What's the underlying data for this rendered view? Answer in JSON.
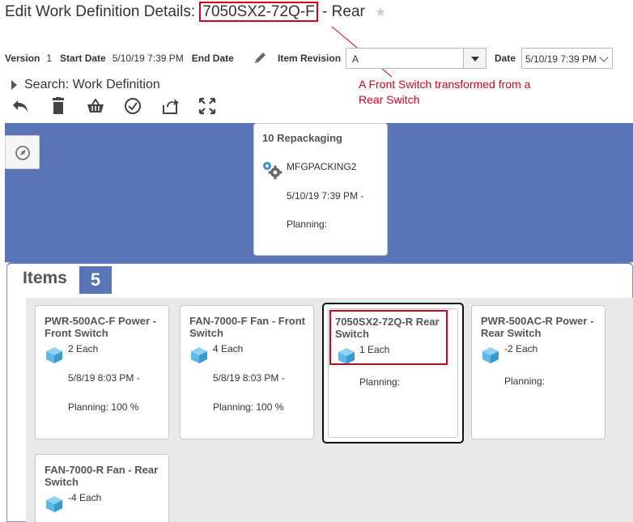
{
  "header": {
    "title_prefix": "Edit Work Definition Details: ",
    "title_item": "7050SX2-72Q-F",
    "title_suffix": " - Rear",
    "star": "★"
  },
  "details": {
    "version_label": "Version",
    "version_value": "1",
    "start_date_label": "Start Date",
    "start_date_value": "5/10/19 7:39 PM",
    "end_date_label": "End Date",
    "item_revision_label": "Item Revision",
    "item_revision_value": "A",
    "date_label": "Date",
    "date_value": "5/10/19 7:39 PM"
  },
  "annotation": "A Front Switch transformed from a Rear Switch",
  "search": {
    "label": "Search: Work Definition"
  },
  "toolbar": [
    "undo-icon",
    "delete-icon",
    "basket-icon",
    "checkmark-icon",
    "refresh-icon",
    "fullscreen-icon"
  ],
  "operation": {
    "title": "10 Repackaging",
    "code": "MFGPACKING2",
    "date": "5/10/19 7:39 PM -",
    "planning": "Planning:"
  },
  "items": {
    "title": "Items",
    "count": "5",
    "cards": [
      {
        "name": "PWR-500AC-F Power - Front Switch",
        "qty": "2 Each",
        "date": "5/8/19 8:03 PM -",
        "planning": "Planning: 100 %"
      },
      {
        "name": "FAN-7000-F Fan - Front Switch",
        "qty": "4 Each",
        "date": "5/8/19 8:03 PM -",
        "planning": "Planning: 100 %"
      },
      {
        "name": "7050SX2-72Q-R Rear Switch",
        "qty": "1 Each",
        "date": "",
        "planning": "Planning:"
      },
      {
        "name": "PWR-500AC-R Power - Rear Switch",
        "qty": "-2 Each",
        "date": "",
        "planning": "Planning:"
      },
      {
        "name": "FAN-7000-R Fan - Rear Switch",
        "qty": "-4 Each",
        "date": "",
        "planning": ""
      }
    ]
  },
  "colors": {
    "accent": "#5a74b8",
    "highlight": "#d0021b",
    "cube": "#5bb8e8"
  }
}
